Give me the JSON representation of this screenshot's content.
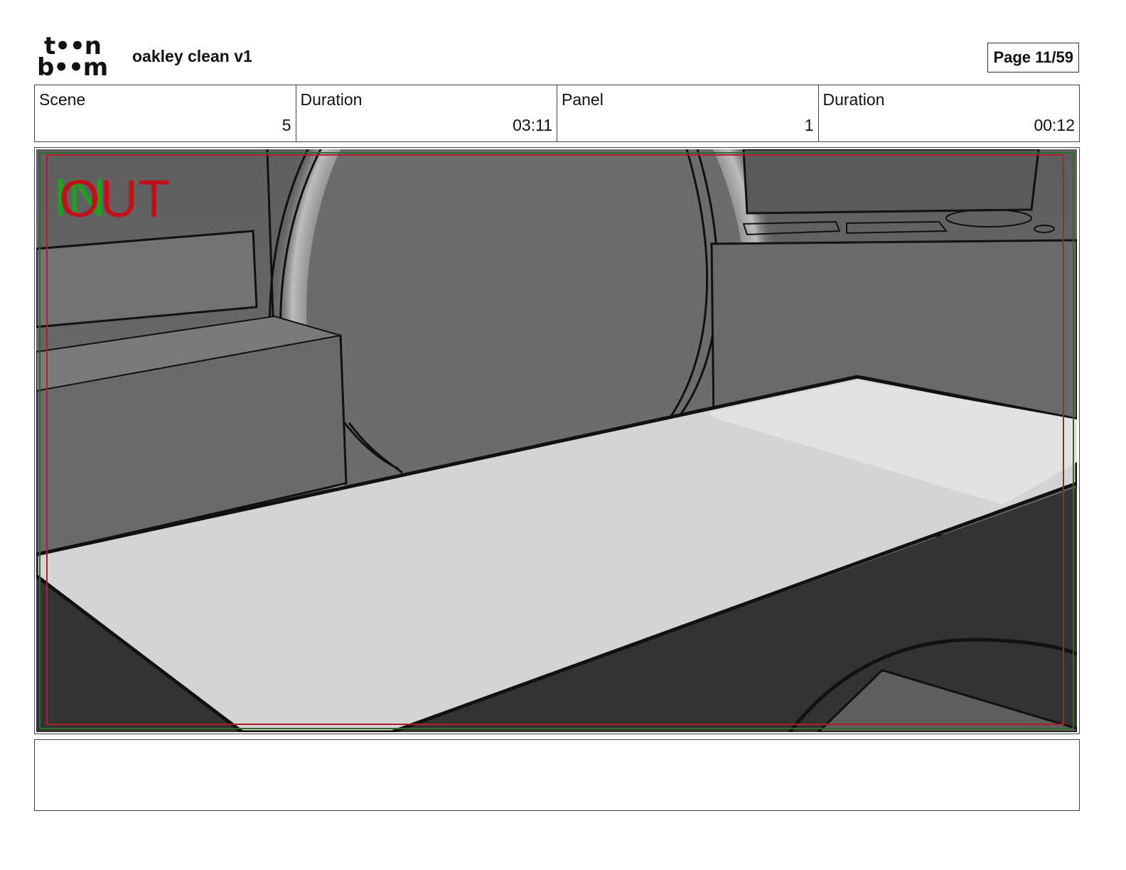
{
  "header": {
    "logo_line1": "t••n",
    "logo_line2": "b••m",
    "document_title": "oakley clean v1",
    "page_label": "Page 11/59"
  },
  "info_table": [
    {
      "label": "Scene",
      "value": "5"
    },
    {
      "label": "Duration",
      "value": "03:11"
    },
    {
      "label": "Panel",
      "value": "1"
    },
    {
      "label": "Duration",
      "value": "00:12"
    }
  ],
  "panel": {
    "in_marker": "IN",
    "out_marker": "OUT",
    "colors": {
      "in_marker": "#1fa31f",
      "out_marker": "#c0111a",
      "safe_frame_red": "#b0202a",
      "safe_frame_green": "#2e6b2e",
      "wall": "#6b6b6b",
      "table_top": "#d4d4d4",
      "table_side": "#333333"
    }
  },
  "notes": {
    "text": ""
  }
}
